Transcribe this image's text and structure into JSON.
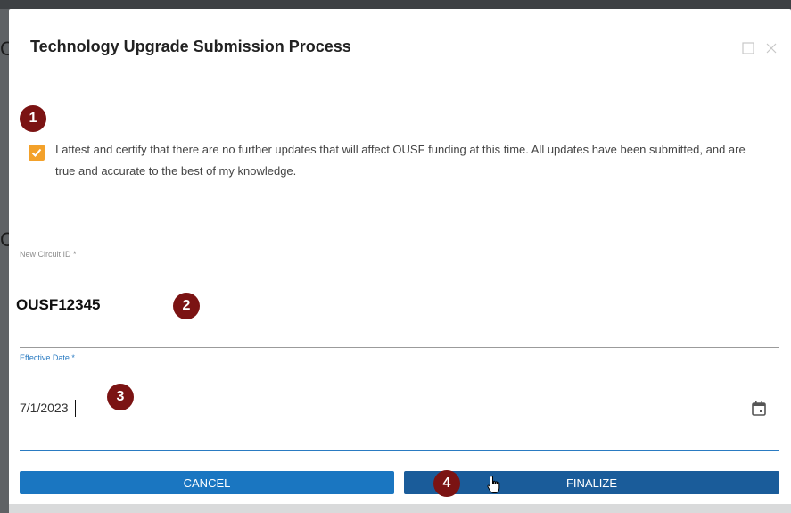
{
  "dialog": {
    "title": "Technology Upgrade Submission Process",
    "controls": [
      "maximize-icon",
      "close-icon"
    ]
  },
  "attestation": {
    "checked": true,
    "text": "I attest and certify that there are no further updates that will affect OUSF funding at this time. All updates have been submitted, and are true and accurate to the best of my knowledge."
  },
  "fields": {
    "circuit": {
      "label": "New Circuit ID *",
      "value": "OUSF12345"
    },
    "date": {
      "label": "Effective Date *",
      "value": "7/1/2023"
    }
  },
  "buttons": {
    "cancel": "CANCEL",
    "finalize": "FINALIZE"
  },
  "markers": [
    "1",
    "2",
    "3",
    "4"
  ],
  "colors": {
    "checkbox": "#f3a12a",
    "marker": "#7b1313",
    "cancel_button": "#1a76c1",
    "finalize_button": "#1a5c9a",
    "focus": "#2a7bc2"
  }
}
